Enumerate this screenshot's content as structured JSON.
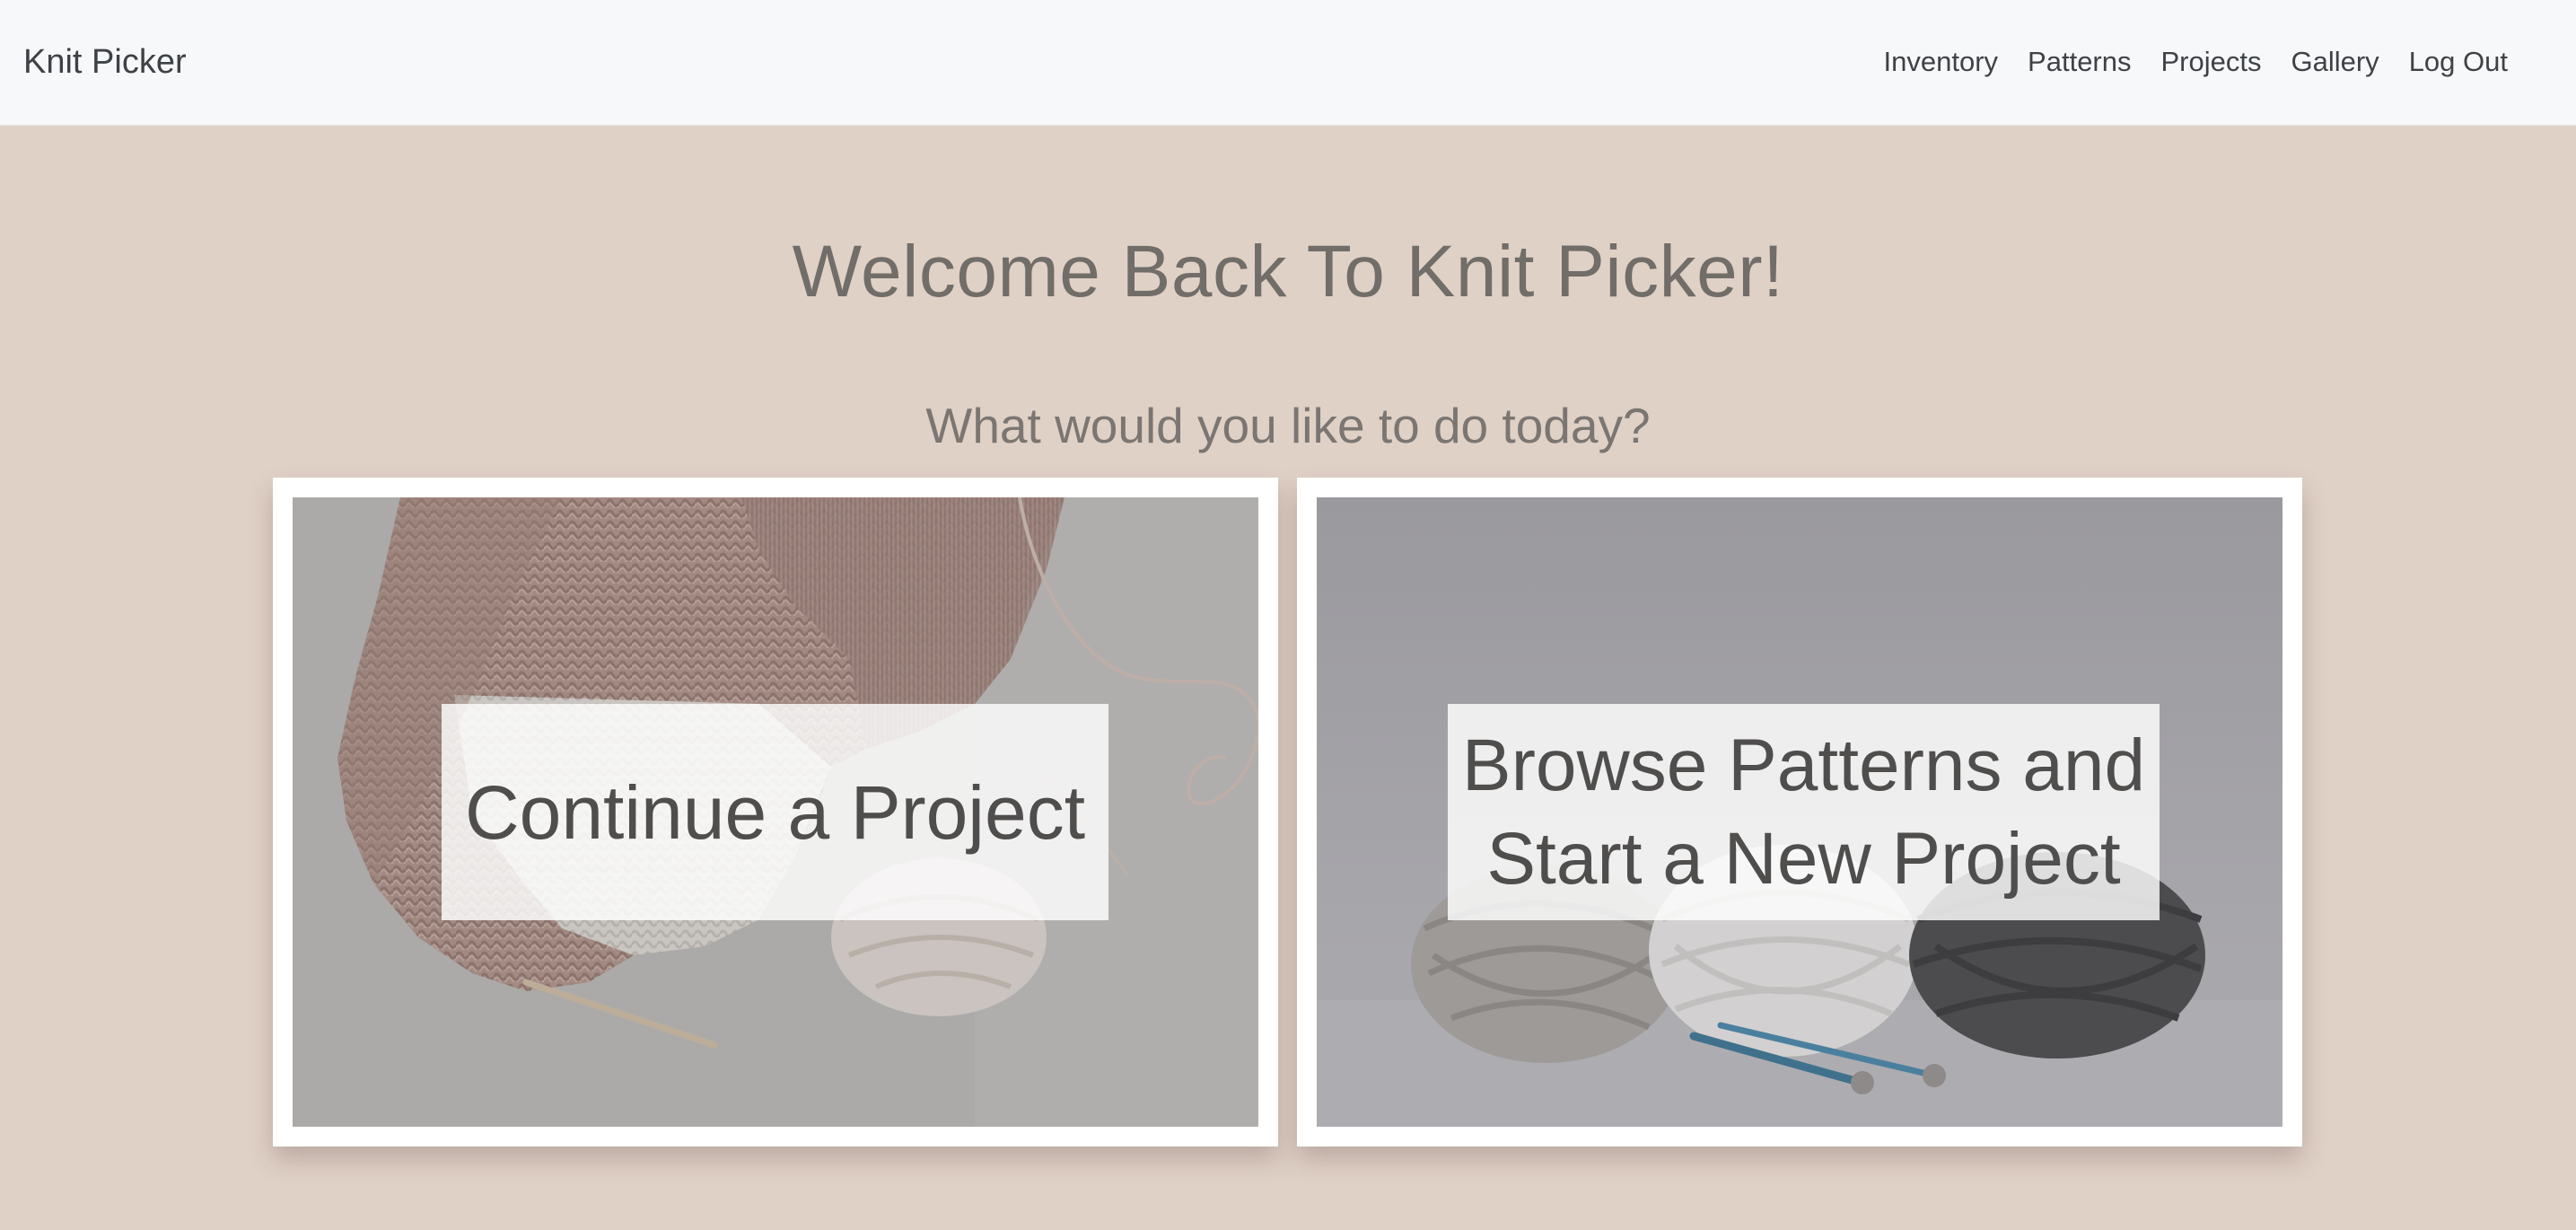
{
  "navbar": {
    "brand": "Knit Picker",
    "links": [
      {
        "label": "Inventory"
      },
      {
        "label": "Patterns"
      },
      {
        "label": "Projects"
      },
      {
        "label": "Gallery"
      },
      {
        "label": "Log Out"
      }
    ]
  },
  "main": {
    "headline": "Welcome Back To Knit Picker!",
    "subheadline": "What would you like to do today?",
    "cards": [
      {
        "label": "Continue a Project",
        "image": "knitted-sweater-and-yarn-photo"
      },
      {
        "label_line1": "Browse Patterns and",
        "label_line2": "Start a New Project",
        "image": "yarn-balls-and-needles-photo"
      }
    ]
  },
  "colors": {
    "page_background": "#e0d1c7",
    "navbar_background": "#f7f8f9",
    "text_dark": "#3e4246",
    "heading": "#716d69",
    "card_border": "#ffffff"
  }
}
